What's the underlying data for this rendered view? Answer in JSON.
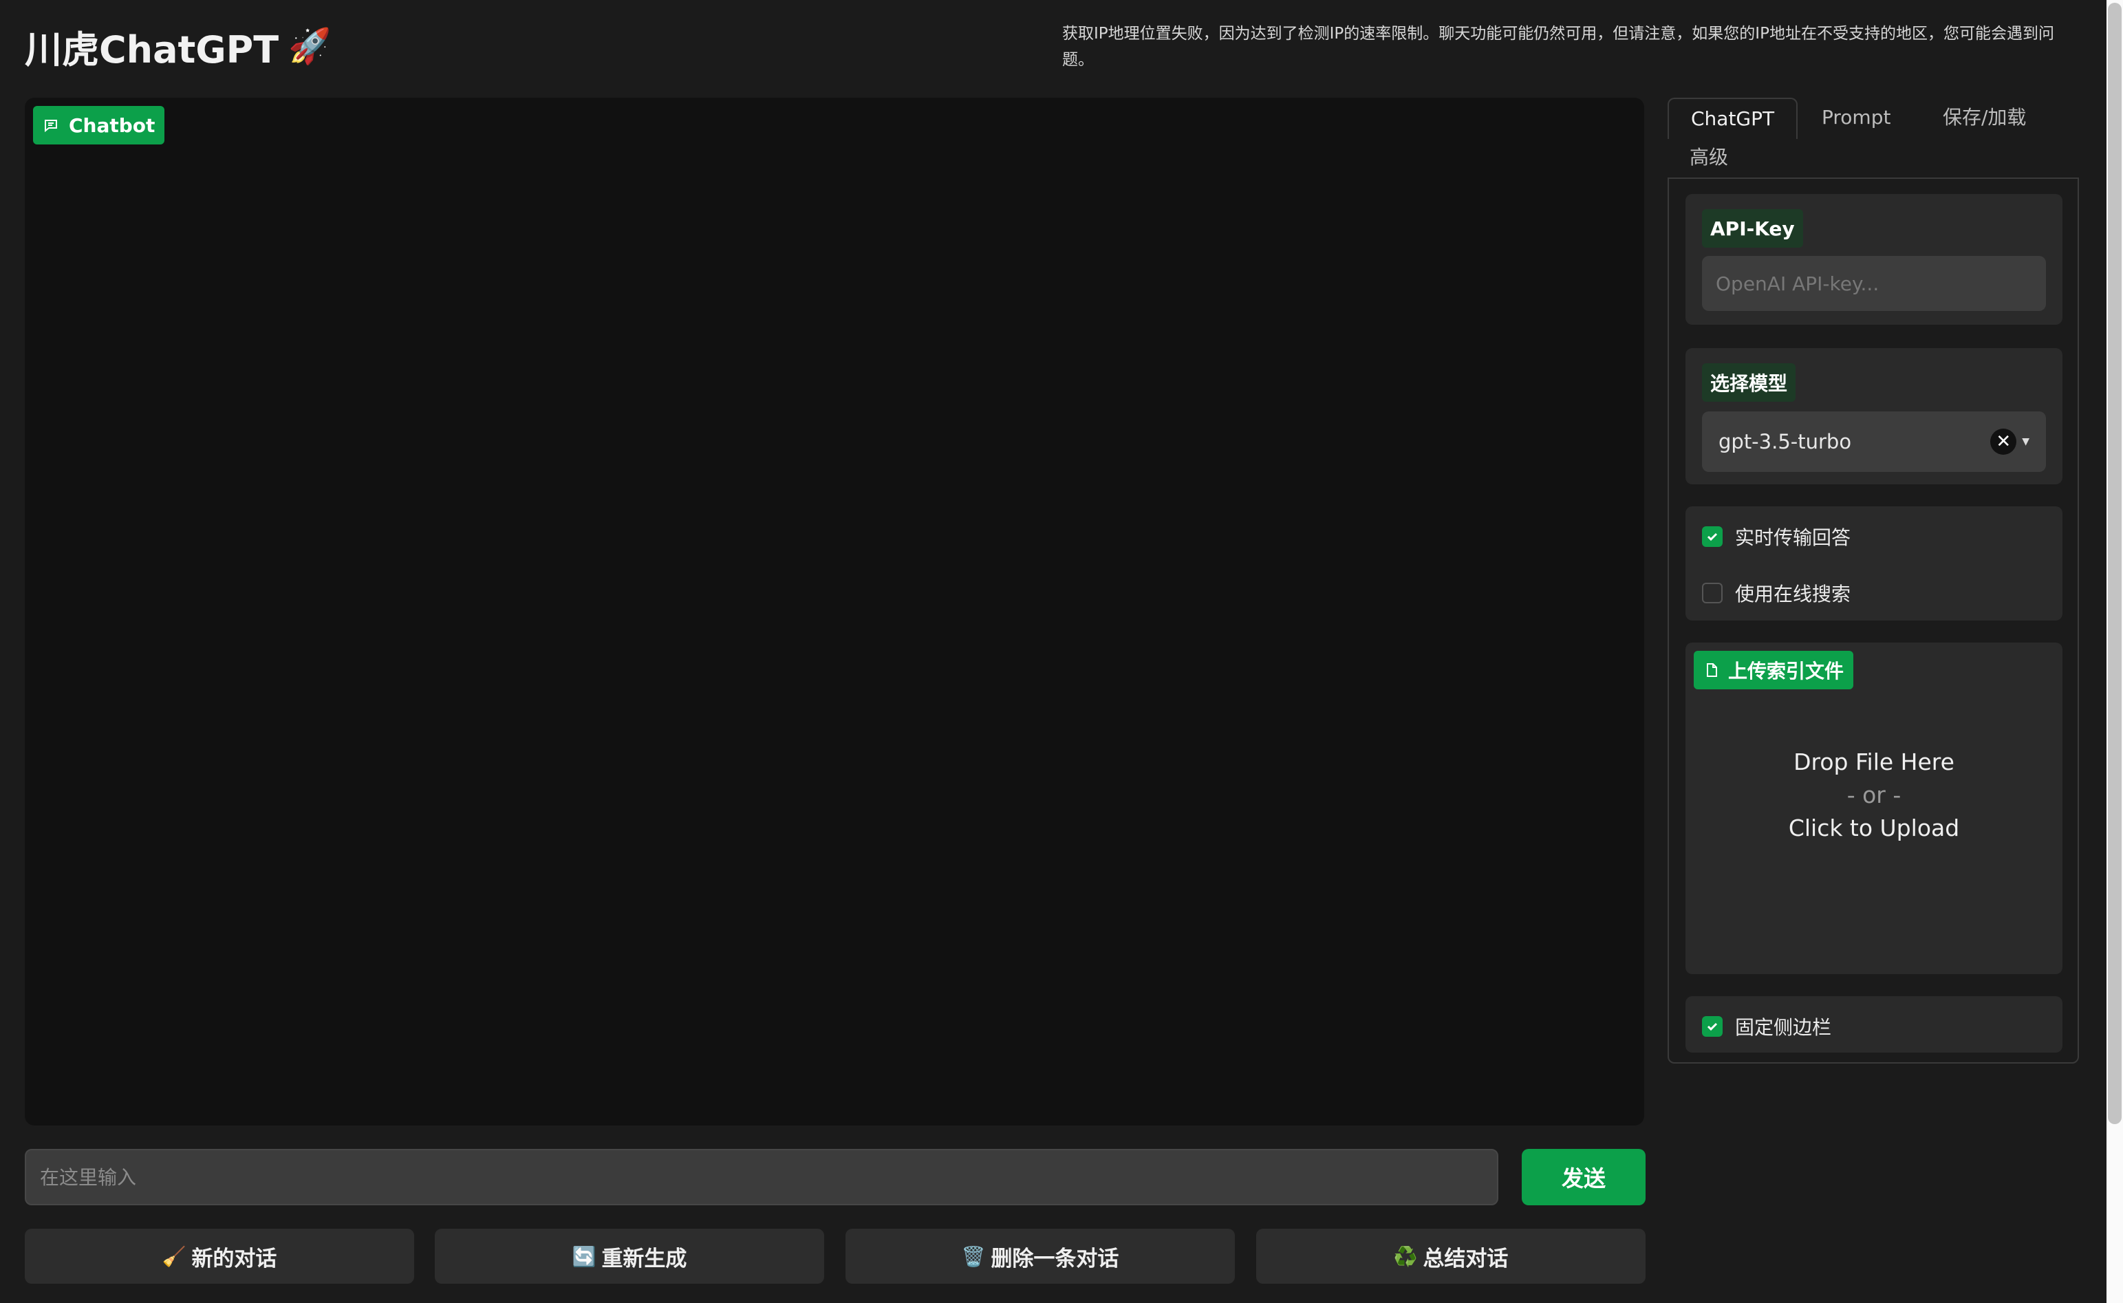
{
  "header": {
    "title": "川虎ChatGPT",
    "title_emoji": "🚀",
    "notice": "获取IP地理位置失败，因为达到了检测IP的速率限制。聊天功能可能仍然可用，但请注意，如果您的IP地址在不受支持的地区，您可能会遇到问题。"
  },
  "chatbot": {
    "label": "Chatbot",
    "icon": "chat-bubble-icon"
  },
  "input": {
    "placeholder": "在这里输入",
    "value": ""
  },
  "send_label": "发送",
  "actions": [
    {
      "icon": "🧹",
      "label": "新的对话"
    },
    {
      "icon": "🔄",
      "label": "重新生成"
    },
    {
      "icon": "🗑️",
      "label": "删除一条对话"
    },
    {
      "icon": "♻️",
      "label": "总结对话"
    }
  ],
  "tabs": [
    "ChatGPT",
    "Prompt",
    "保存/加载",
    "高级"
  ],
  "active_tab": "ChatGPT",
  "sidebar": {
    "api_key": {
      "label": "API-Key",
      "placeholder": "OpenAI API-key...",
      "value": ""
    },
    "model": {
      "label": "选择模型",
      "value": "gpt-3.5-turbo"
    },
    "stream_checkbox": {
      "label": "实时传输回答",
      "checked": true
    },
    "search_checkbox": {
      "label": "使用在线搜索",
      "checked": false
    },
    "upload": {
      "label": "上传索引文件",
      "line1": "Drop File Here",
      "line2": "- or -",
      "line3": "Click to Upload"
    },
    "pin_checkbox": {
      "label": "固定侧边栏",
      "checked": true
    }
  },
  "colors": {
    "accent": "#0ca04a",
    "background": "#1b1b1b",
    "panel": "#111111"
  }
}
